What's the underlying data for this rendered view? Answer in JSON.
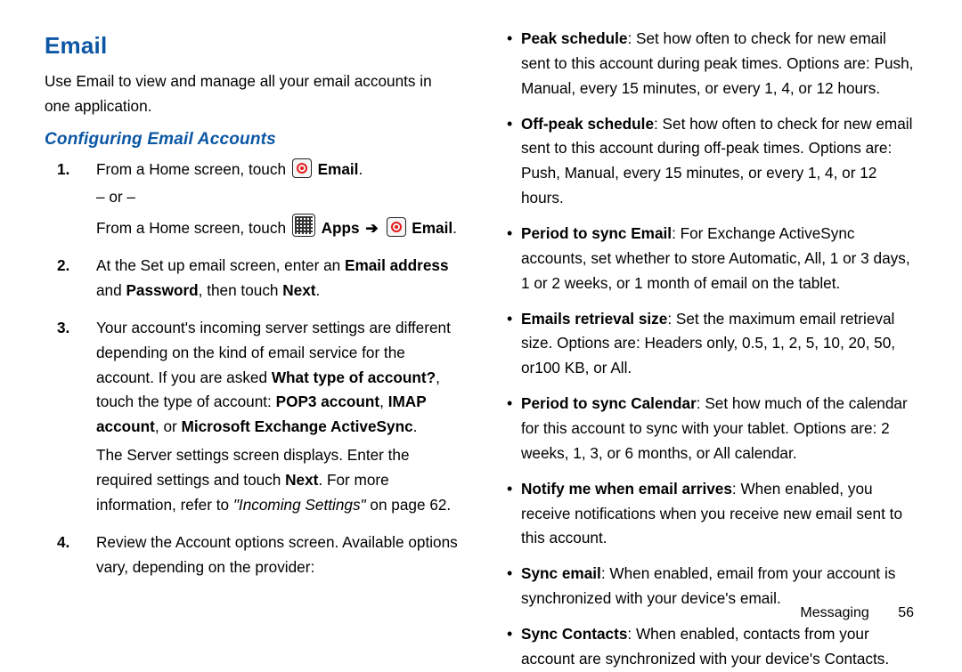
{
  "heading": "Email",
  "intro": "Use Email to view and manage all your email accounts in one application.",
  "subheading": "Configuring Email Accounts",
  "steps": {
    "s1": {
      "num": "1.",
      "pre": "From a Home screen, touch ",
      "email_label": " Email",
      "or": "– or –",
      "pre2": "From a Home screen, touch ",
      "apps_label": " Apps ",
      "arrow": "➔",
      "email_label2": " Email",
      "period": "."
    },
    "s2": {
      "num": "2.",
      "a": "At the Set up email screen, enter an ",
      "b": "Email address",
      "c": " and ",
      "d": "Password",
      "e": ", then touch ",
      "f": "Next",
      "g": "."
    },
    "s3": {
      "num": "3.",
      "p1a": "Your account's incoming server settings are different depending on the kind of email service for the account. If you are asked ",
      "p1b": "What type of account?",
      "p1c": ", touch the type of account: ",
      "p1d": "POP3 account",
      "p1e": ", ",
      "p1f": "IMAP account",
      "p1g": ", or ",
      "p1h": "Microsoft Exchange ActiveSync",
      "p1i": ".",
      "p2a": "The Server settings screen displays. Enter the required settings and touch ",
      "p2b": "Next",
      "p2c": ". For more information, refer to ",
      "p2d": "\"Incoming Settings\"",
      "p2e": " on page 62."
    },
    "s4": {
      "num": "4.",
      "text": "Review the Account options screen. Available options vary, depending on the provider:"
    }
  },
  "bullets": {
    "b1": {
      "t": "Peak schedule",
      "r": ": Set how often to check for new email sent to this account during peak times. Options are: Push, Manual, every 15 minutes, or every 1, 4, or 12 hours."
    },
    "b2": {
      "t": "Off-peak schedule",
      "r": ": Set how often to check for new email sent to this account during off-peak times. Options are: Push, Manual, every 15 minutes, or every 1, 4, or 12 hours."
    },
    "b3": {
      "t": "Period to sync Email",
      "r": ": For Exchange ActiveSync accounts, set whether to store Automatic, All, 1 or 3 days, 1 or 2 weeks, or 1 month of email on the tablet."
    },
    "b4": {
      "t": "Emails retrieval size",
      "r": ": Set the maximum email retrieval size. Options are: Headers only, 0.5, 1, 2, 5, 10, 20, 50, or100 KB, or All."
    },
    "b5": {
      "t": "Period to sync Calendar",
      "r": ": Set how much of the calendar for this account to sync with your tablet. Options are: 2 weeks, 1, 3, or 6 months, or All calendar."
    },
    "b6": {
      "t": "Notify me when email arrives",
      "r": ": When enabled, you receive notifications when you receive new email sent to this account."
    },
    "b7": {
      "t": "Sync email",
      "r": ": When enabled, email from your account is synchronized with your device's email."
    },
    "b8": {
      "t": "Sync Contacts",
      "r": ": When enabled, contacts from your account are synchronized with your device's Contacts."
    }
  },
  "footer": {
    "section": "Messaging",
    "page": "56"
  }
}
